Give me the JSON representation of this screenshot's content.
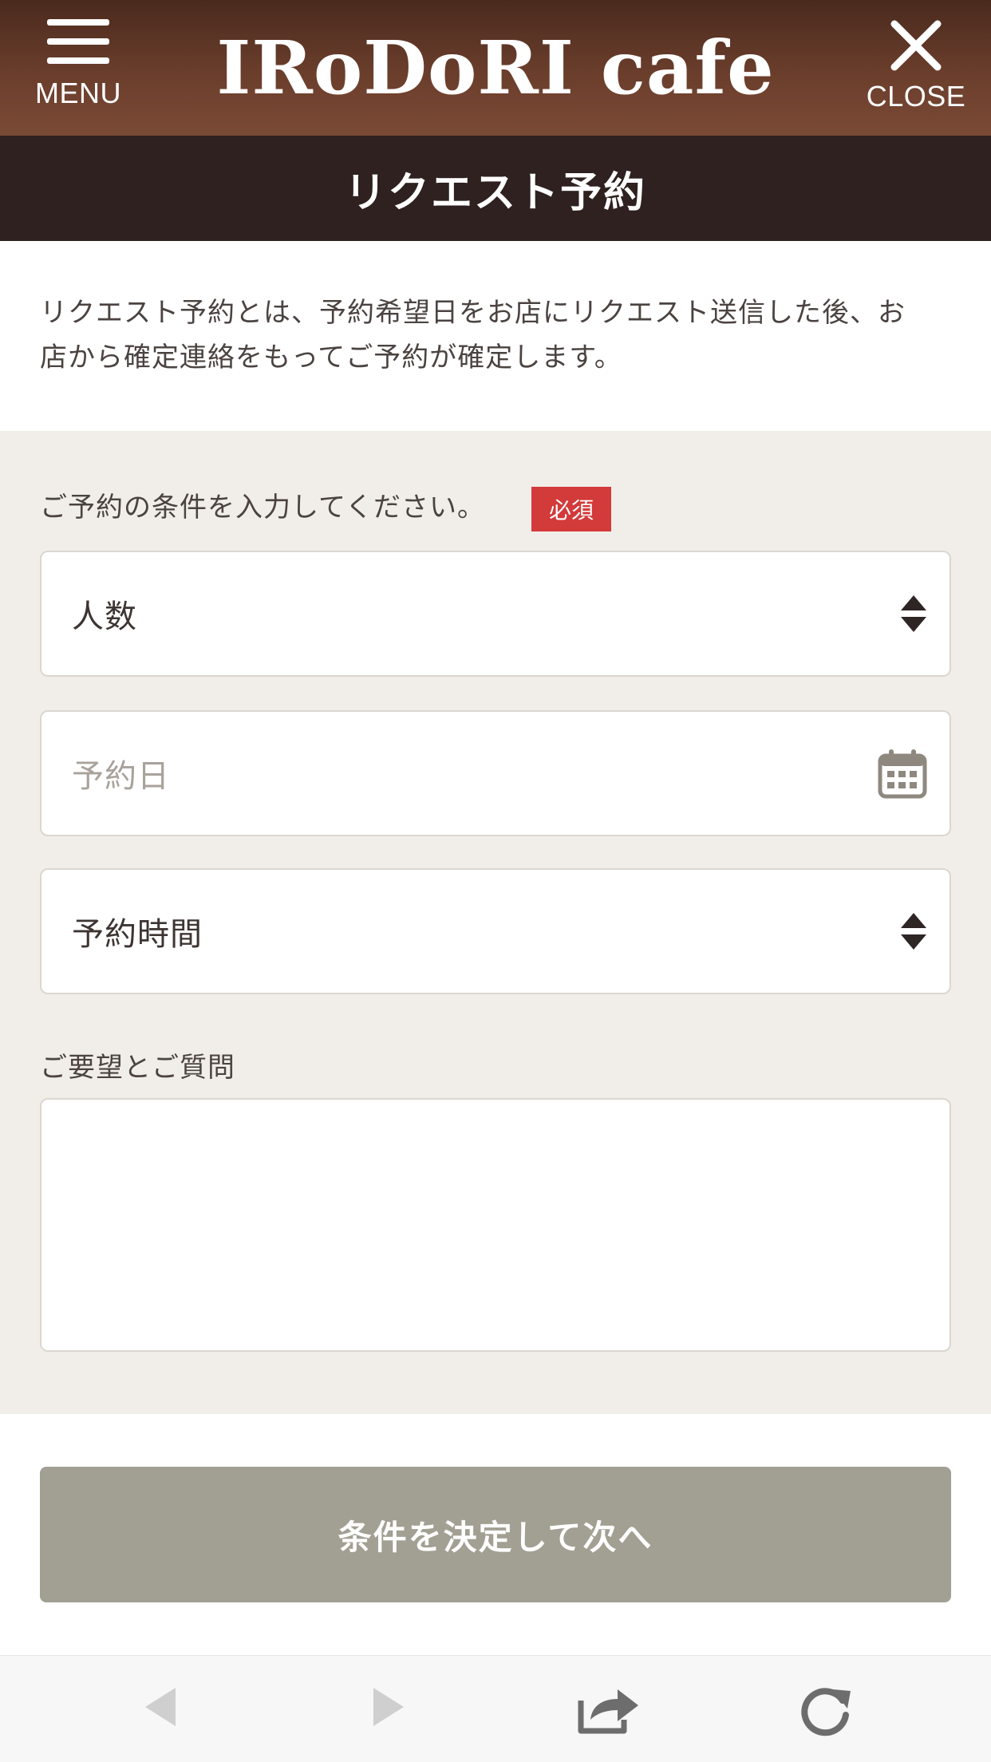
{
  "header": {
    "menu_label": "MENU",
    "brand": "IRoDoRI cafe",
    "close_label": "CLOSE"
  },
  "title_bar": {
    "title": "リクエスト予約"
  },
  "intro": {
    "text_line1": "リクエスト予約とは、予約希望日をお店にリクエスト送信した後、お",
    "text_line2": "店から確定連絡をもってご予約が確定します。"
  },
  "form": {
    "section_label": "ご予約の条件を入力してください。",
    "required_badge": "必須",
    "party_size": {
      "value": "人数",
      "icon": "updown-select-icon"
    },
    "date": {
      "placeholder": "予約日",
      "icon": "calendar-icon"
    },
    "time": {
      "value": "予約時間",
      "icon": "updown-select-icon"
    },
    "requests_label": "ご要望とご質問",
    "requests_value": ""
  },
  "submit": {
    "label": "条件を決定して次へ"
  },
  "browser_toolbar": {
    "icons": [
      "back-arrow-icon",
      "forward-arrow-icon",
      "share-icon",
      "reload-icon"
    ]
  },
  "colors": {
    "header_brown": "#6b3e2c",
    "title_bar": "#2e211f",
    "form_bg": "#f1eeea",
    "required_red": "#d33a3a",
    "submit_gray": "#a29f93"
  }
}
